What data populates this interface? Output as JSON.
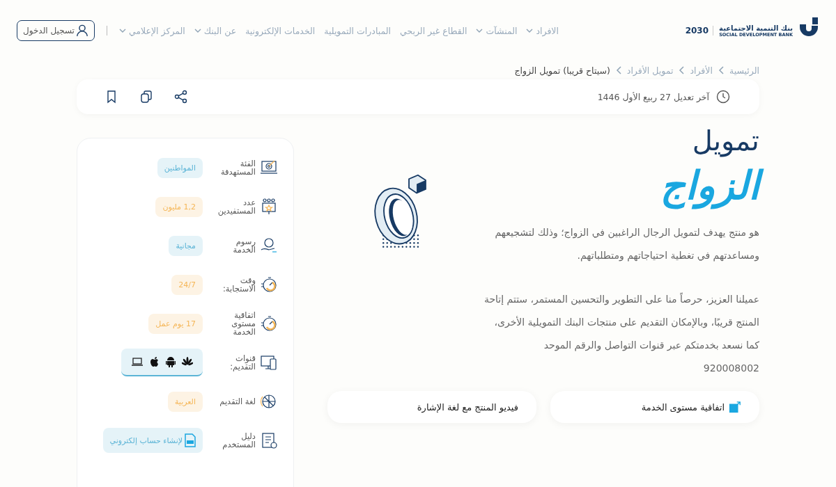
{
  "header": {
    "bank_name": "بنك التنمية الاجتماعية",
    "bank_name_en": "SOCIAL DEVELOPMENT BANK",
    "vision": "2030",
    "nav": [
      {
        "label": "الافراد",
        "dropdown": true
      },
      {
        "label": "المنشآت",
        "dropdown": true
      },
      {
        "label": "القطاع غير الربحي",
        "dropdown": false
      },
      {
        "label": "المبادرات التمويلية",
        "dropdown": false
      },
      {
        "label": "الخدمات الإلكترونية",
        "dropdown": false
      },
      {
        "label": "عن البنك",
        "dropdown": true
      },
      {
        "label": "المركز الإعلامي",
        "dropdown": true
      }
    ],
    "login": "تسجيل الدخول"
  },
  "breadcrumb": [
    {
      "label": "الرئيسية",
      "current": false
    },
    {
      "label": "الأفراد",
      "current": false
    },
    {
      "label": "تمويل الأفراد",
      "current": false
    },
    {
      "label": "(سيتاح قريبا) تمويل الزواج",
      "current": true
    }
  ],
  "toolbar": {
    "last_modified": "آخر تعديل 27 ربيع الأول 1446"
  },
  "title": {
    "line1": "تمويل",
    "line2": "الزواج"
  },
  "paragraphs": [
    [
      "هو منتج يهدف لتمويل الرجال الراغبين في الزواج؛ وذلك لتشجيعهم ومساعدتهم في تغطية احتياجاتهم ومتطلباتهم."
    ],
    [
      "عميلنا العزيز، حرصاً منا على التطوير والتحسين المستمر، ستتم إتاحة المنتج قريبًا، وبالإمكان التقديم على منتجات البنك التمويلية الأخرى،",
      "كما نسعد بخدمتكم عبر قنوات التواصل والرقم الموحد",
      "920008002"
    ]
  ],
  "links": [
    {
      "label": "اتفاقية مستوى الخدمة",
      "kind": "external"
    },
    {
      "label": "فيديو المنتج مع لغة الإشارة",
      "kind": "plain"
    }
  ],
  "details": [
    {
      "label": "الفئة المستهدفة",
      "kind": "text",
      "value": "المواطنين",
      "color": "#5bb4d6"
    },
    {
      "label": "عدد المستفيدين",
      "kind": "text",
      "value": "1,2 مليون",
      "color": "#f5b657"
    },
    {
      "label": "رسوم الخدمة",
      "kind": "text",
      "value": "مجانية",
      "color": "#5bb4d6"
    },
    {
      "label": "وقت الاستجابة:",
      "kind": "text",
      "value": "24/7",
      "color": "#f5b657"
    },
    {
      "label": "اتفاقية مستوى الخدمة",
      "kind": "text",
      "value": "17 يوم عمل",
      "color": "#f5b657"
    },
    {
      "label": "قنوات التقديم:",
      "kind": "channels",
      "color": "#5bb4d6"
    },
    {
      "label": "لغة التقديم",
      "kind": "text",
      "value": "العربية",
      "color": "#f5b657"
    },
    {
      "label": "دليل المستخدم",
      "kind": "file",
      "value": "لإنشاء حساب إلكتروني",
      "color": "#5bb4d6"
    }
  ]
}
